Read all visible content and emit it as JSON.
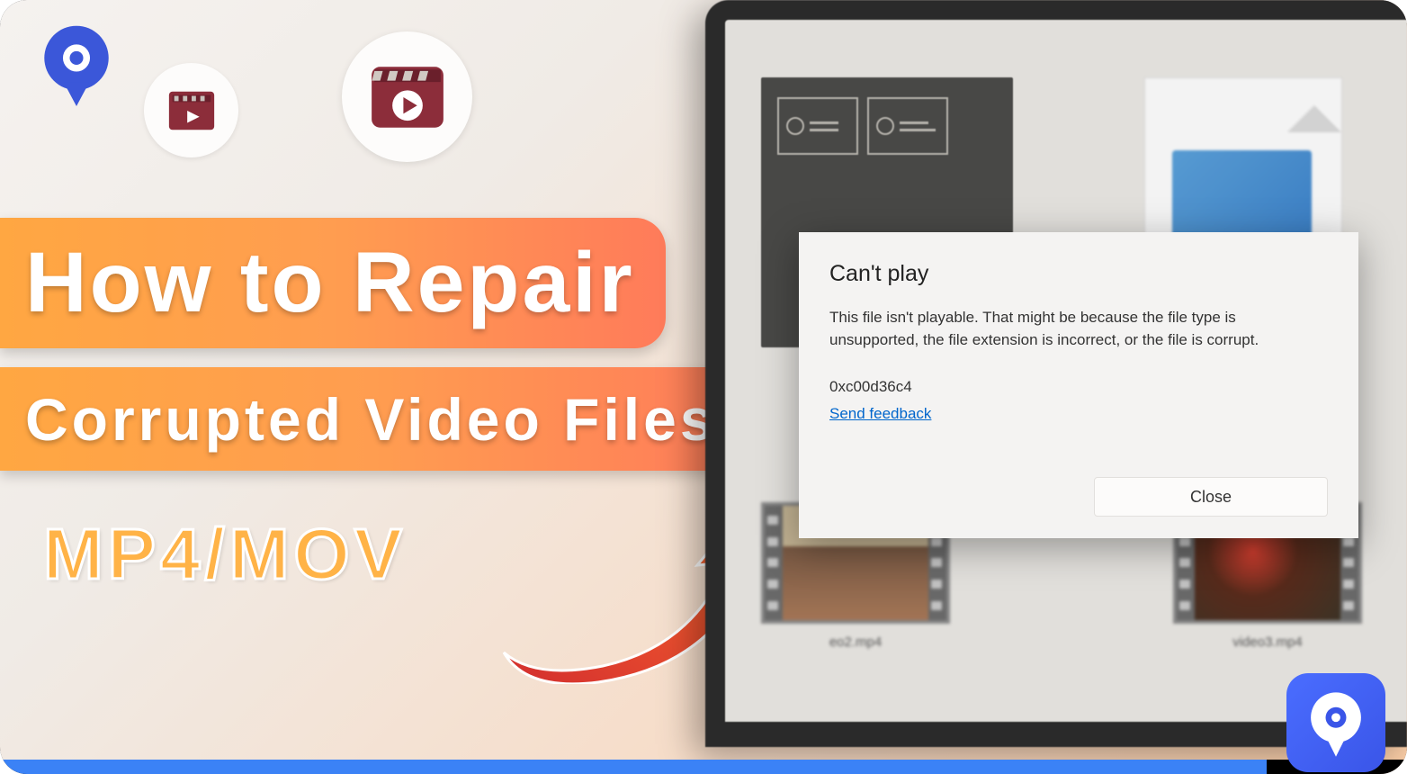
{
  "title": {
    "line1": "How to Repair",
    "line2": "Corrupted Video Files",
    "subtitle": "MP4/MOV"
  },
  "dialog": {
    "title": "Can't play",
    "body": "This file isn't playable. That might be because the file type is unsupported, the file extension is incorrect, or the file is corrupt.",
    "code": "0xc00d36c4",
    "feedback_link": "Send feedback",
    "close_button": "Close"
  },
  "thumbnails": {
    "file2": "eo2.mp4",
    "file3": "video3.mp4"
  },
  "icons": {
    "logo": "recoverit-logo",
    "video1": "video-play-icon",
    "video2": "clapperboard-play-icon",
    "arrow": "curved-arrow-icon"
  },
  "progress_percent": 90
}
